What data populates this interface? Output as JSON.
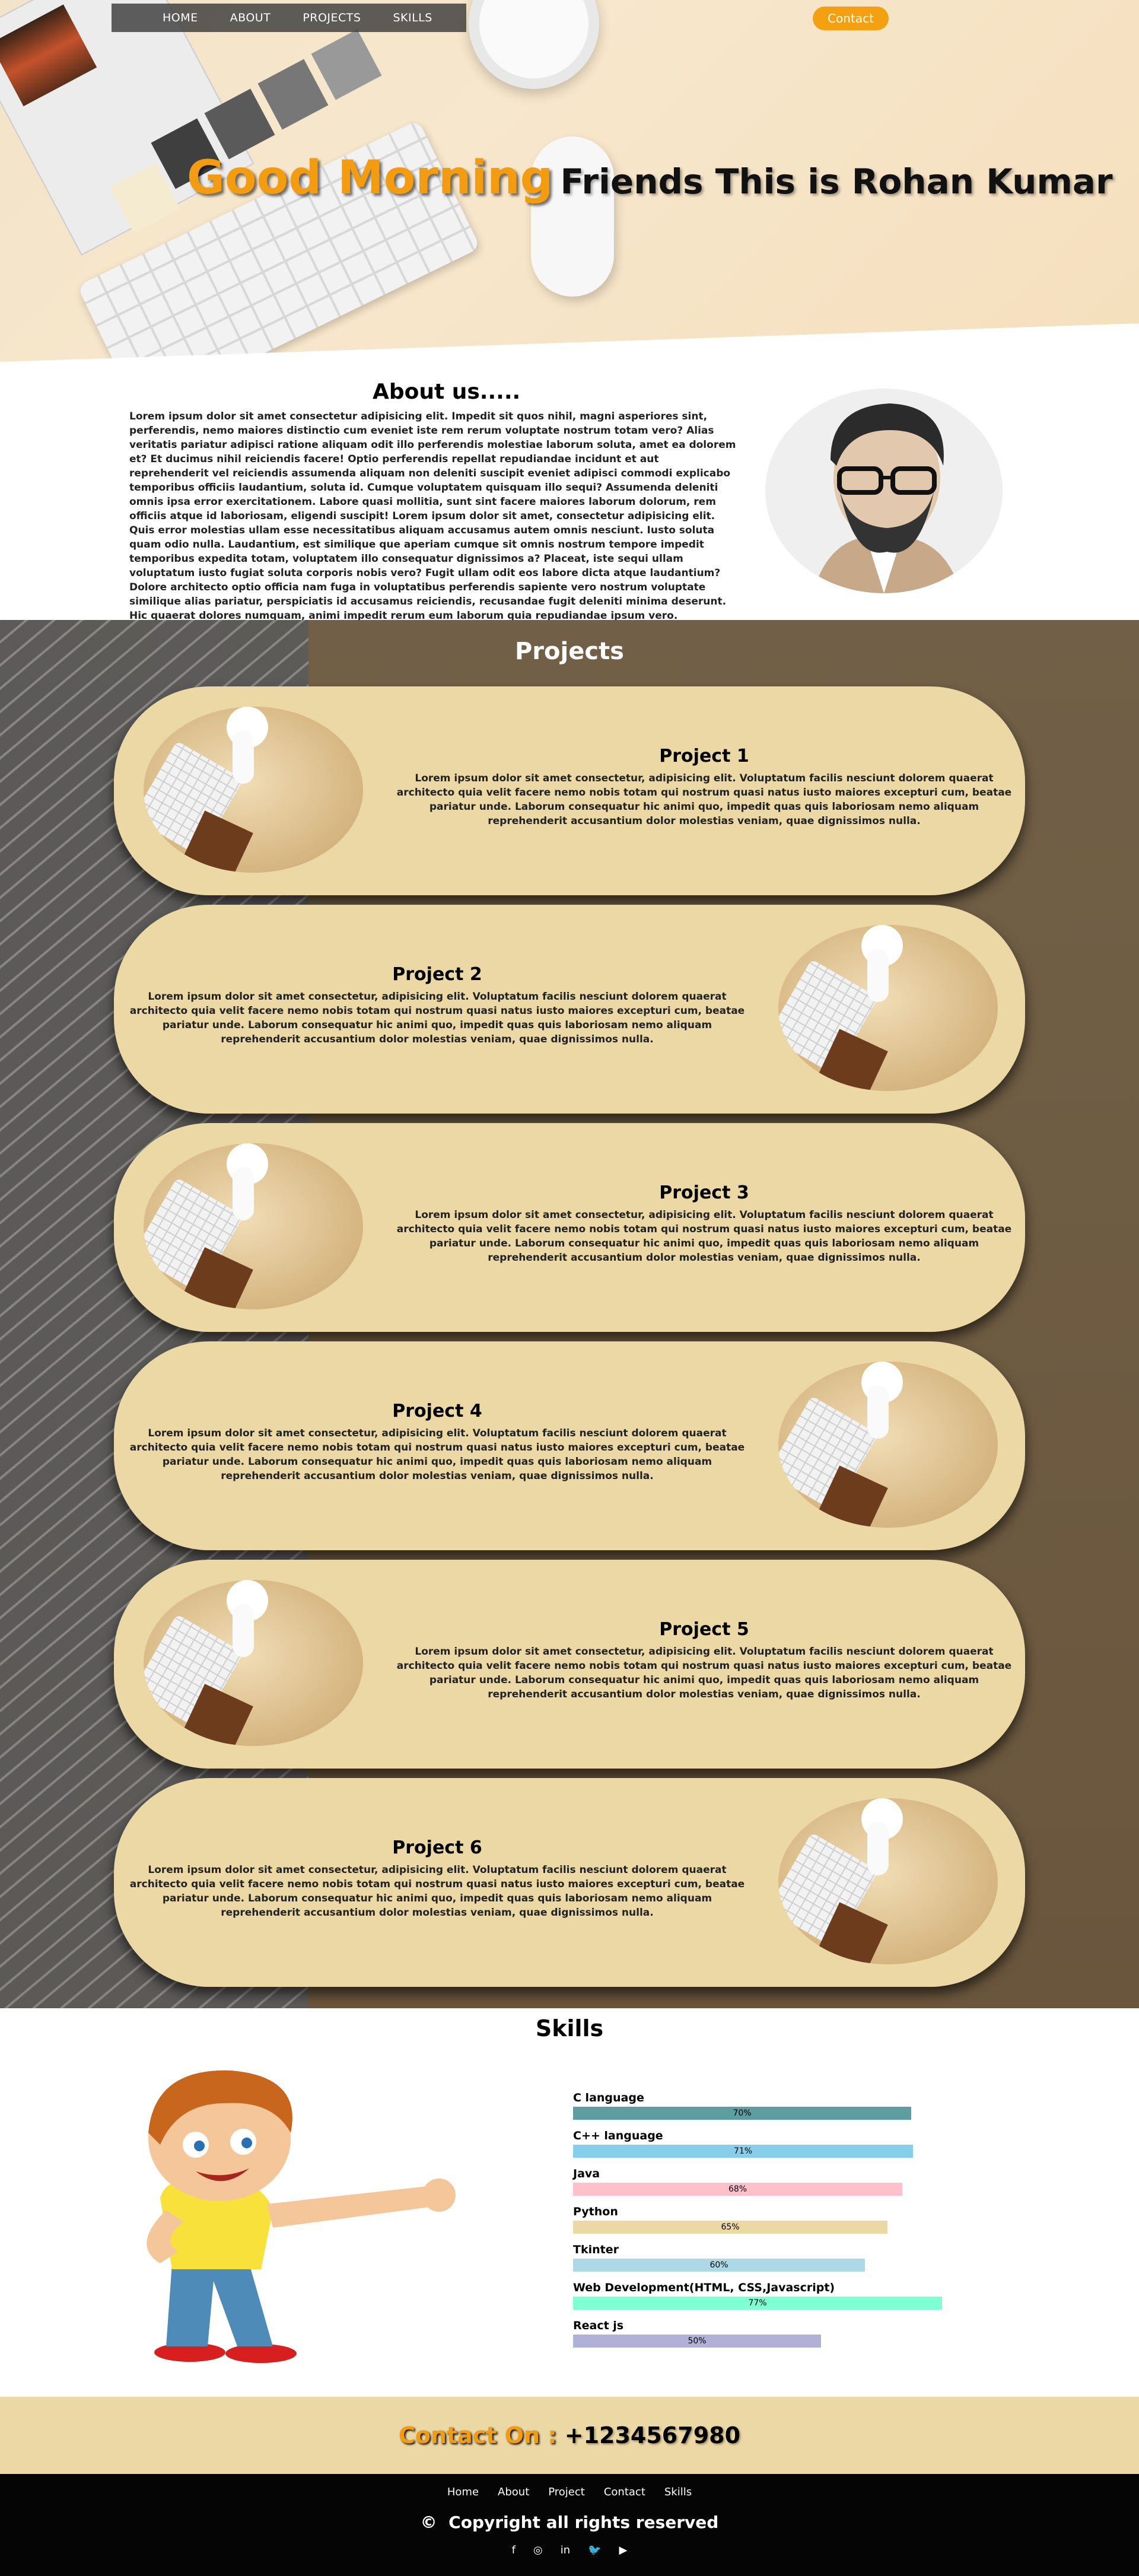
{
  "nav": {
    "links": [
      "HOME",
      "ABOUT",
      "PROJECTS",
      "SKILLS"
    ],
    "contact_label": "Contact"
  },
  "hero": {
    "greeting": "Good Morning",
    "title_rest": "Friends This is Rohan Kumar"
  },
  "about": {
    "title": "About us.....",
    "text": "Lorem ipsum dolor sit amet consectetur adipisicing elit. Impedit sit quos nihil, magni asperiores sint, perferendis, nemo maiores distinctio cum eveniet iste rem rerum voluptate nostrum totam vero? Alias veritatis pariatur adipisci ratione aliquam odit illo perferendis molestiae laborum soluta, amet ea dolorem et? Et ducimus nihil reiciendis facere! Optio perferendis repellat repudiandae incidunt et aut reprehenderit vel reiciendis assumenda aliquam non deleniti suscipit eveniet adipisci commodi explicabo temporibus officiis laudantium, soluta id. Cumque voluptatem quisquam illo sequi? Assumenda deleniti omnis ipsa error exercitationem. Labore quasi mollitia, sunt sint facere maiores laborum dolorum, rem officiis atque id laboriosam, eligendi suscipit! Lorem ipsum dolor sit amet, consectetur adipisicing elit. Quis error molestias ullam esse necessitatibus aliquam accusamus autem omnis nesciunt. Iusto soluta quam odio nulla. Laudantium, est similique que aperiam cumque sit omnis nostrum tempore impedit temporibus expedita totam, voluptatem illo consequatur dignissimos a? Placeat, iste sequi ullam voluptatum iusto fugiat soluta corporis nobis vero? Fugit ullam odit eos labore dicta atque laudantium? Dolore architecto optio officia nam fuga in voluptatibus perferendis sapiente vero nostrum voluptate similique alias pariatur, perspiciatis id accusamus reiciendis, recusandae fugit deleniti minima deserunt. Hic quaerat dolores numquam, animi impedit rerum eum laborum quia repudiandae ipsum vero."
  },
  "projects": {
    "title": "Projects",
    "description": "Lorem ipsum dolor sit amet consectetur, adipisicing elit. Voluptatum facilis nesciunt dolorem quaerat architecto quia velit facere nemo nobis totam qui nostrum quasi natus iusto maiores excepturi cum, beatae pariatur unde. Laborum consequatur hic animi quo, impedit quas quis laboriosam nemo aliquam reprehenderit accusantium dolor molestias veniam, quae dignissimos nulla.",
    "items": [
      {
        "name": "Project 1"
      },
      {
        "name": "Project 2"
      },
      {
        "name": "Project 3"
      },
      {
        "name": "Project 4"
      },
      {
        "name": "Project 5"
      },
      {
        "name": "Project 6"
      }
    ]
  },
  "skills": {
    "title": "Skills",
    "items": [
      {
        "label": "C language",
        "percent": 70,
        "text": "70%",
        "color": "#5f9ea0"
      },
      {
        "label": "C++ language",
        "percent": 71,
        "text": "71%",
        "color": "#87ceeb"
      },
      {
        "label": "Java",
        "percent": 68,
        "text": "68%",
        "color": "#ffc0cb"
      },
      {
        "label": "Python",
        "percent": 65,
        "text": "65%",
        "color": "#ecd8a4"
      },
      {
        "label": "Tkinter",
        "percent": 60,
        "text": "60%",
        "color": "#add8e6"
      },
      {
        "label": "Web Development(HTML, CSS,Javascript)",
        "percent": 77,
        "text": "77%",
        "color": "#7fffd4"
      },
      {
        "label": "React js",
        "percent": 50,
        "text": "50%",
        "color": "#b0b0d8"
      }
    ]
  },
  "contact": {
    "label": "Contact On :",
    "number": "+1234567980"
  },
  "footer": {
    "links": [
      "Home",
      "About",
      "Project",
      "Contact",
      "Skills"
    ],
    "copyright_symbol": "©",
    "copyright": "Copyright all rights reserved",
    "social": [
      "f",
      "◎",
      "in",
      "🐦",
      "▶"
    ]
  },
  "colors": {
    "accent": "#f39c12",
    "cream": "#ecd8a4",
    "footer": "#050505"
  }
}
